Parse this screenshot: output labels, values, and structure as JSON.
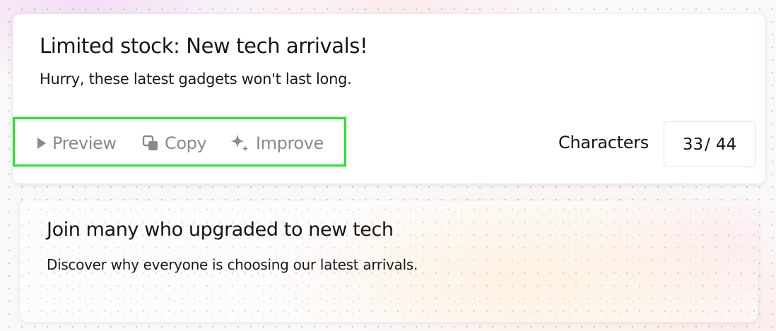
{
  "ad_cards": [
    {
      "headline": "Limited stock: New tech arrivals!",
      "description": "Hurry, these latest gadgets won't last long."
    },
    {
      "headline": "Join many who upgraded to new tech",
      "description": "Discover why everyone is choosing our latest arrivals."
    }
  ],
  "actions": {
    "preview_label": "Preview",
    "copy_label": "Copy",
    "improve_label": "Improve",
    "icons": {
      "preview": "play-triangle-icon",
      "copy": "copy-icon",
      "improve": "sparkle-icon"
    }
  },
  "character_count": {
    "label": "Characters",
    "current": "33",
    "separator": "/",
    "max": "44"
  },
  "colors": {
    "highlight_outline": "#22e822",
    "action_text": "#8a8a8a",
    "primary_text": "#151515"
  }
}
